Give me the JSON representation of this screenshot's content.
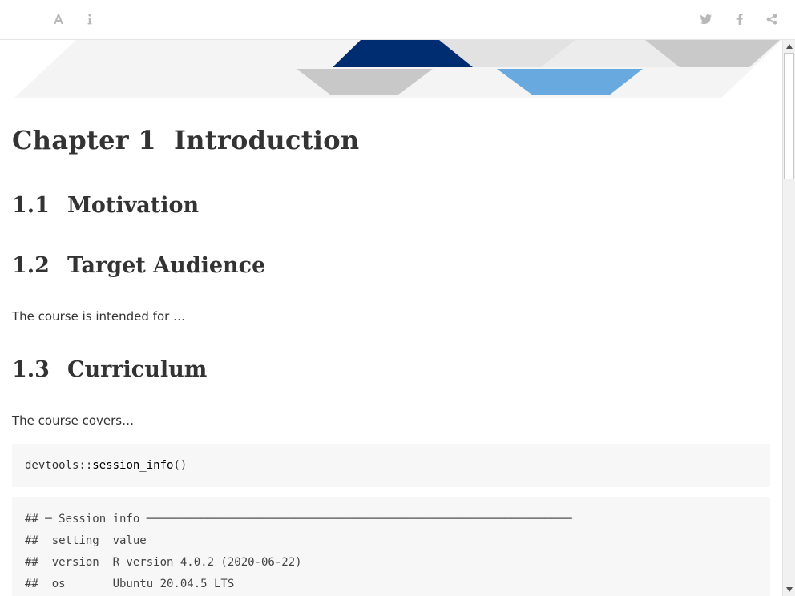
{
  "toolbar": {
    "left_icons": [
      "font-settings-icon",
      "info-icon"
    ],
    "right_icons": [
      "twitter-icon",
      "facebook-icon",
      "share-icon"
    ],
    "icon_color": "#b8b8b8"
  },
  "banner": {
    "colors": {
      "dark_blue": "#002d72",
      "light_blue": "#68a9e0",
      "grey": "#c8c8c8",
      "light_grey": "#e2e2e2"
    }
  },
  "main": {
    "chapter": {
      "number": "Chapter 1",
      "title": "Introduction"
    },
    "sections": [
      {
        "number": "1.1",
        "title": "Motivation"
      },
      {
        "number": "1.2",
        "title": "Target Audience",
        "text": "The course is intended for …"
      },
      {
        "number": "1.3",
        "title": "Curriculum",
        "text": "The course covers…"
      }
    ],
    "code_input": {
      "pkg": "devtools",
      "sep": "::",
      "fn": "session_info",
      "args": "()"
    },
    "code_output": [
      "## ─ Session info ───────────────────────────────────────────────────────────────",
      "##  setting  value",
      "##  version  R version 4.0.2 (2020-06-22)",
      "##  os       Ubuntu 20.04.5 LTS"
    ]
  }
}
